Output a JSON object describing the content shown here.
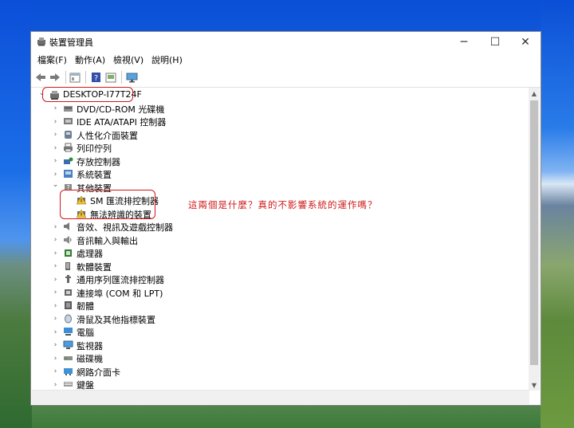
{
  "window": {
    "title": "裝置管理員",
    "minimize": "─",
    "maximize": "☐",
    "close": "✕"
  },
  "menu": [
    "檔案(F)",
    "動作(A)",
    "檢視(V)",
    "說明(H)"
  ],
  "toolbar": [
    "back-icon",
    "forward-icon",
    "properties-icon",
    "help-icon",
    "update-icon",
    "monitor-icon"
  ],
  "tree": {
    "root": "DESKTOP-I77T24F",
    "items": [
      {
        "label": "DVD/CD-ROM 光碟機",
        "icon": "dvd-drive-icon",
        "expanded": false
      },
      {
        "label": "IDE ATA/ATAPI 控制器",
        "icon": "ide-controller-icon",
        "expanded": false
      },
      {
        "label": "人性化介面裝置",
        "icon": "hid-icon",
        "expanded": false
      },
      {
        "label": "列印佇列",
        "icon": "printer-icon",
        "expanded": false
      },
      {
        "label": "存放控制器",
        "icon": "storage-controller-icon",
        "expanded": false
      },
      {
        "label": "系統裝置",
        "icon": "system-device-icon",
        "expanded": false
      },
      {
        "label": "其他裝置",
        "icon": "other-devices-icon",
        "expanded": true
      },
      {
        "label": "SM 匯流排控制器",
        "icon": "warning-device-icon",
        "child": true
      },
      {
        "label": "無法辨識的裝置",
        "icon": "warning-device-icon",
        "child": true
      },
      {
        "label": "音效、視訊及遊戲控制器",
        "icon": "sound-icon",
        "expanded": false
      },
      {
        "label": "音訊輸入與輸出",
        "icon": "audio-io-icon",
        "expanded": false
      },
      {
        "label": "處理器",
        "icon": "processor-icon",
        "expanded": false
      },
      {
        "label": "軟體裝置",
        "icon": "software-device-icon",
        "expanded": false
      },
      {
        "label": "通用序列匯流排控制器",
        "icon": "usb-icon",
        "expanded": false
      },
      {
        "label": "連接埠 (COM 和 LPT)",
        "icon": "port-icon",
        "expanded": false
      },
      {
        "label": "韌體",
        "icon": "firmware-icon",
        "expanded": false
      },
      {
        "label": "滑鼠及其他指標裝置",
        "icon": "mouse-icon",
        "expanded": false
      },
      {
        "label": "電腦",
        "icon": "computer-icon",
        "expanded": false
      },
      {
        "label": "監視器",
        "icon": "monitor-icon",
        "expanded": false
      },
      {
        "label": "磁碟機",
        "icon": "disk-drive-icon",
        "expanded": false
      },
      {
        "label": "網路介面卡",
        "icon": "network-adapter-icon",
        "expanded": false
      },
      {
        "label": "鍵盤",
        "icon": "keyboard-icon",
        "expanded": false
      }
    ]
  },
  "annotation": {
    "text": "這兩個是什麼？真的不影響系統的運作嗎？",
    "color": "#d01818"
  }
}
